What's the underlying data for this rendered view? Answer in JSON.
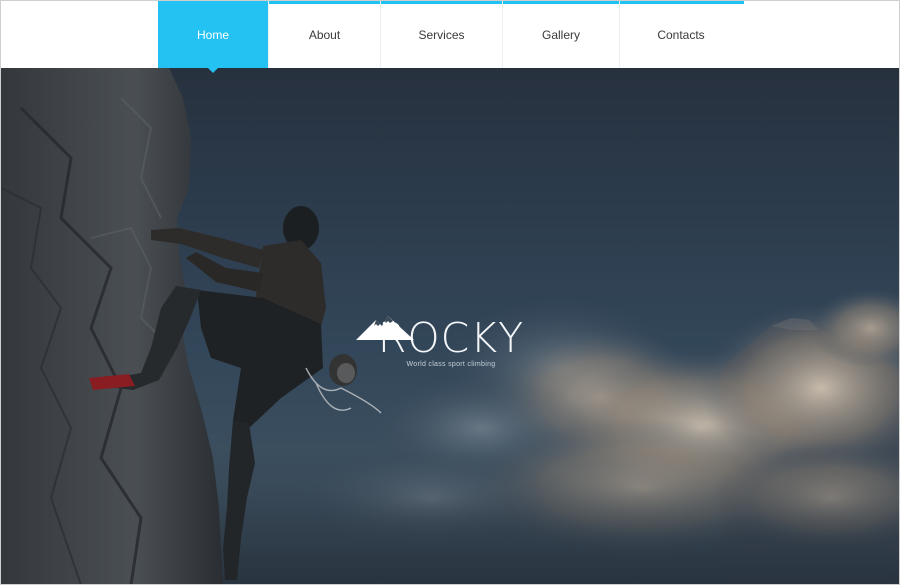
{
  "nav": {
    "items": [
      {
        "label": "Home",
        "active": true
      },
      {
        "label": "About",
        "active": false
      },
      {
        "label": "Services",
        "active": false
      },
      {
        "label": "Gallery",
        "active": false
      },
      {
        "label": "Contacts",
        "active": false
      }
    ],
    "accent_color": "#24c1f3"
  },
  "hero": {
    "logo_icon": "mountain-icon",
    "title": "ROCKY",
    "tagline": "World class sport climbing",
    "image": "climber on rock face above clouds"
  }
}
